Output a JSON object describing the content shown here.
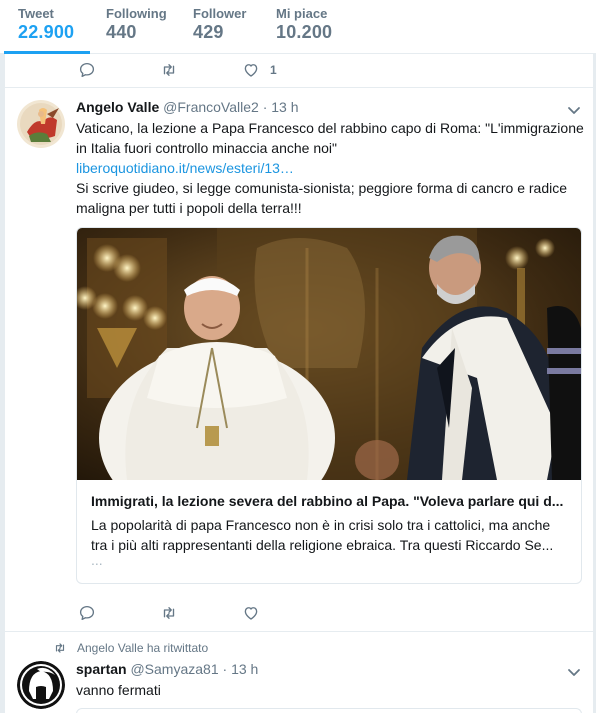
{
  "stats": [
    {
      "label": "Tweet",
      "value": "22.900"
    },
    {
      "label": "Following",
      "value": "440"
    },
    {
      "label": "Follower",
      "value": "429"
    },
    {
      "label": "Mi piace",
      "value": "10.200"
    }
  ],
  "prev_tweet": {
    "like_count": "1"
  },
  "tweet1": {
    "name": "Angelo Valle",
    "handle": "@FrancoValle2",
    "time": "13 h",
    "text_line1": "Vaticano, la lezione a Papa Francesco del rabbino capo di Roma: \"L'immigrazione",
    "text_line2": "in Italia fuori controllo minaccia anche noi\"",
    "link": "liberoquotidiano.it/news/esteri/13…",
    "text_line3": "Si scrive giudeo, si legge comunista-sionista; peggiore forma di cancro e radice",
    "text_line4": "maligna per tutti i popoli della terra!!!",
    "card": {
      "title": "Immigrati, la lezione severa del rabbino al Papa. \"Voleva parlare qui d...",
      "desc_line1": "La popolarità di papa Francesco non è in crisi solo tra i cattolici, ma anche",
      "desc_line2": "tra i più alti rappresentanti della religione ebraica. Tra questi Riccardo Se...",
      "desc_line3": "..."
    }
  },
  "retweet_note": "Angelo Valle ha ritwittato",
  "tweet2": {
    "name": "spartan",
    "handle": "@Samyaza81",
    "time": "13 h",
    "text": "vanno fermati"
  },
  "colors": {
    "accent": "#1da1f2",
    "link": "#1b95e0",
    "muted": "#657786",
    "border": "#e6ecf0"
  },
  "icons": [
    "reply-icon",
    "retweet-icon",
    "like-icon",
    "chevron-down-icon",
    "spartan-helmet-icon"
  ]
}
